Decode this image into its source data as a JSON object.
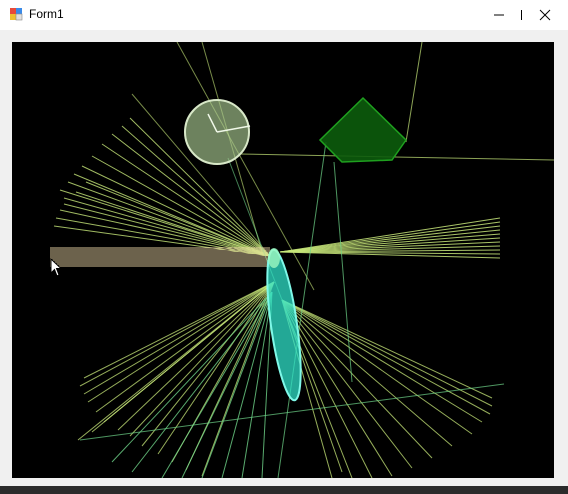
{
  "window": {
    "title": "Form1",
    "controls": {
      "minimize": "minimize-icon",
      "maximize": "maximize-icon",
      "close": "close-icon"
    }
  },
  "canvas": {
    "background": "#000000",
    "ray_color": "#c8e87a",
    "ray_color_alt": "#6fd58a",
    "lens_color": "#2fe0c8",
    "circle_color": "#a8c890",
    "pentagon_color": "#0c5c0c",
    "beam_color": "#f0d8a8"
  }
}
